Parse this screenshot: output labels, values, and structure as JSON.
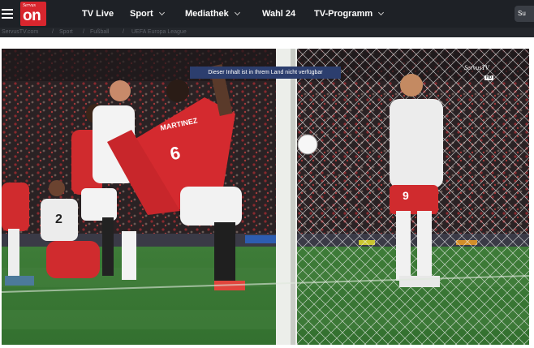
{
  "header": {
    "logo_small": "Servus",
    "logo_big": "on",
    "nav": [
      {
        "label": "TV Live",
        "has_dropdown": false
      },
      {
        "label": "Sport",
        "has_dropdown": true
      },
      {
        "label": "Mediathek",
        "has_dropdown": true
      },
      {
        "label": "Wahl 24",
        "has_dropdown": false
      },
      {
        "label": "TV-Programm",
        "has_dropdown": true
      }
    ],
    "search_label": "Su"
  },
  "breadcrumb": [
    "ServusTV.com",
    "/",
    "Sport",
    "/",
    "Fußball",
    "/",
    "UEFA Europa League"
  ],
  "video": {
    "notice": "Dieser Inhalt ist in Ihrem Land nicht verfügbar",
    "watermark": "ServusTV",
    "watermark_badge": "HD",
    "player_name": "MARTINEZ",
    "player_number": "6",
    "opponent_number_left": "2",
    "opponent_number_right": "9",
    "colors": {
      "home_red": "#d42a2f",
      "away_white": "#ececec",
      "pitch_green": "#3a7a36"
    }
  }
}
